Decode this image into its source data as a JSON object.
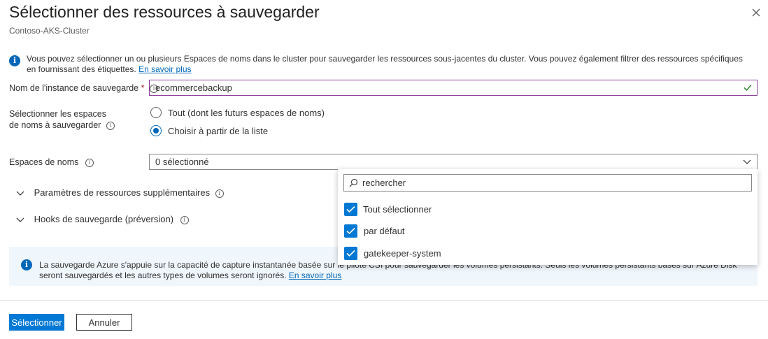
{
  "header": {
    "title": "Sélectionner des ressources à sauvegarder",
    "subtitle": "Contoso-AKS-Cluster"
  },
  "info": {
    "text": "Vous pouvez sélectionner un ou plusieurs Espaces de noms dans le cluster pour sauvegarder les ressources sous-jacentes du cluster. Vous pouvez également filtrer des ressources spécifiques en fournissant des étiquettes.",
    "link": "En savoir plus"
  },
  "form": {
    "instance_label": "Nom de l'instance de sauvegarde",
    "required_mark": "*",
    "instance_value": "ecommercebackup",
    "namespaces_select_label_line1": "Sélectionner les espaces",
    "namespaces_select_label_line2": "de noms à sauvegarder",
    "radio_all": "Tout (dont les futurs espaces de noms)",
    "radio_list": "Choisir à partir de la liste",
    "namespaces_label": "Espaces de noms",
    "namespaces_value": "0 sélectionné"
  },
  "sections": {
    "extra_params": "Paramètres de ressources supplémentaires",
    "hooks": "Hooks de sauvegarde (préversion)"
  },
  "note": {
    "text": "La sauvegarde Azure s'appuie sur la capacité de capture instantanée basée sur le pilote CSI pour sauvegarder les volumes persistants. Seuls les volumes persistants basés sur Azure Disk seront sauvegardés et les autres types de volumes seront ignorés.",
    "link": "En savoir plus"
  },
  "dropdown_panel": {
    "search_placeholder": "rechercher",
    "options": [
      {
        "label": "Tout sélectionner",
        "checked": true
      },
      {
        "label": "par défaut",
        "checked": true
      },
      {
        "label": "gatekeeper-system",
        "checked": true
      }
    ]
  },
  "footer": {
    "primary": "Sélectionner",
    "secondary": "Annuler"
  },
  "colors": {
    "accent": "#0078d4",
    "link": "#0067b8",
    "focus_border": "#8a3d98",
    "note_bg": "#eff6fc",
    "valid_check": "#107c10"
  },
  "icons": [
    "close-icon",
    "info-icon",
    "tooltip-icon",
    "checkmark-icon",
    "chevron-down-icon",
    "search-icon",
    "checkbox-checked-icon"
  ]
}
